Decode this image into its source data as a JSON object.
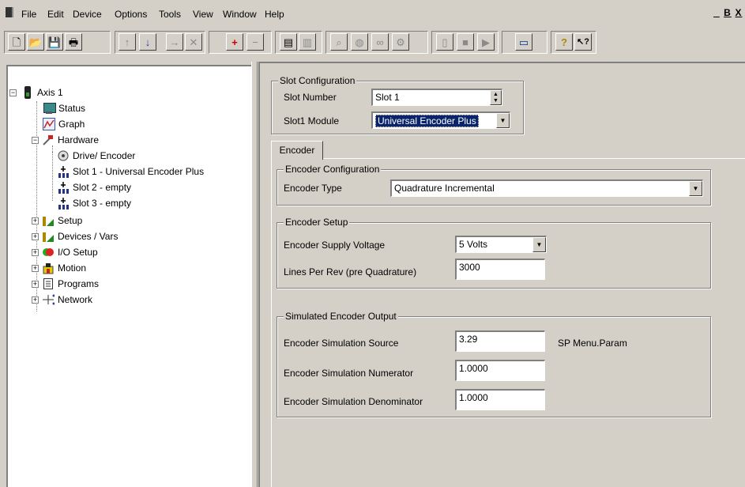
{
  "menubar": {
    "items": [
      "File",
      "Edit",
      "Device",
      "Options",
      "Tools",
      "View",
      "Window",
      "Help"
    ],
    "mdi_controls": [
      "_",
      "B",
      "X"
    ]
  },
  "toolbar": {
    "buttons": [
      {
        "icon": "new-file-icon",
        "glyph": "🗋"
      },
      {
        "icon": "open-folder-icon",
        "glyph": "📂"
      },
      {
        "icon": "save-icon",
        "glyph": "💾"
      },
      {
        "icon": "print-icon",
        "glyph": "🖶"
      },
      {
        "icon": "upload-icon",
        "glyph": "↑"
      },
      {
        "icon": "download-icon",
        "glyph": "↓"
      },
      {
        "icon": "insert-icon",
        "glyph": "→"
      },
      {
        "icon": "delete-icon",
        "glyph": "✕"
      },
      {
        "icon": "add-axis-icon",
        "glyph": "+"
      },
      {
        "icon": "remove-axis-icon",
        "glyph": "−"
      },
      {
        "icon": "properties-icon",
        "glyph": "▤"
      },
      {
        "icon": "copy-properties-icon",
        "glyph": "▥"
      },
      {
        "icon": "zoom-icon",
        "glyph": "⌕"
      },
      {
        "icon": "watch-icon",
        "glyph": "◍"
      },
      {
        "icon": "scope-icon",
        "glyph": "∞"
      },
      {
        "icon": "tune-icon",
        "glyph": "⚙"
      },
      {
        "icon": "drive-icon",
        "glyph": "▯"
      },
      {
        "icon": "stop-icon",
        "glyph": "■"
      },
      {
        "icon": "run-icon",
        "glyph": "▶"
      },
      {
        "icon": "window-icon",
        "glyph": "▭"
      },
      {
        "icon": "help-icon",
        "glyph": "?"
      },
      {
        "icon": "context-help-icon",
        "glyph": "↖?"
      }
    ]
  },
  "tree": {
    "root": {
      "label": "Axis 1"
    },
    "items": [
      {
        "label": "Status",
        "icon": "status-icon"
      },
      {
        "label": "Graph",
        "icon": "graph-icon"
      },
      {
        "label": "Hardware",
        "icon": "hardware-icon"
      },
      {
        "label": "Drive/ Encoder",
        "icon": "drive-encoder-icon"
      },
      {
        "label": "Slot 1 - Universal Encoder Plus",
        "icon": "slot-icon"
      },
      {
        "label": "Slot 2 - empty",
        "icon": "slot-icon"
      },
      {
        "label": "Slot 3 - empty",
        "icon": "slot-icon"
      },
      {
        "label": "Setup",
        "icon": "setup-icon"
      },
      {
        "label": "Devices / Vars",
        "icon": "devices-icon"
      },
      {
        "label": "I/O Setup",
        "icon": "io-icon"
      },
      {
        "label": "Motion",
        "icon": "motion-icon"
      },
      {
        "label": "Programs",
        "icon": "programs-icon"
      },
      {
        "label": "Network",
        "icon": "network-icon"
      }
    ]
  },
  "slot_config": {
    "title": "Slot Configuration",
    "slot_number_label": "Slot Number",
    "slot_number_value": "Slot 1",
    "module_label": "Slot1 Module",
    "module_value": "Universal Encoder Plus"
  },
  "tabs": {
    "encoder": "Encoder"
  },
  "encoder_config": {
    "title": "Encoder Configuration",
    "type_label": "Encoder Type",
    "type_value": "Quadrature Incremental"
  },
  "encoder_setup": {
    "title": "Encoder Setup",
    "supply_label": "Encoder Supply Voltage",
    "supply_value": "5 Volts",
    "lines_label": "Lines Per Rev (pre Quadrature)",
    "lines_value": "3000"
  },
  "sim_output": {
    "title": "Simulated Encoder Output",
    "source_label": "Encoder Simulation Source",
    "source_value": "3.29",
    "source_hint": "SP Menu.Param",
    "numerator_label": "Encoder Simulation Numerator",
    "numerator_value": "1.0000",
    "denominator_label": "Encoder Simulation Denominator",
    "denominator_value": "1.0000"
  },
  "colors": {
    "face": "#d4d0c8",
    "selection": "#0a246a",
    "window": "#ffffff"
  }
}
